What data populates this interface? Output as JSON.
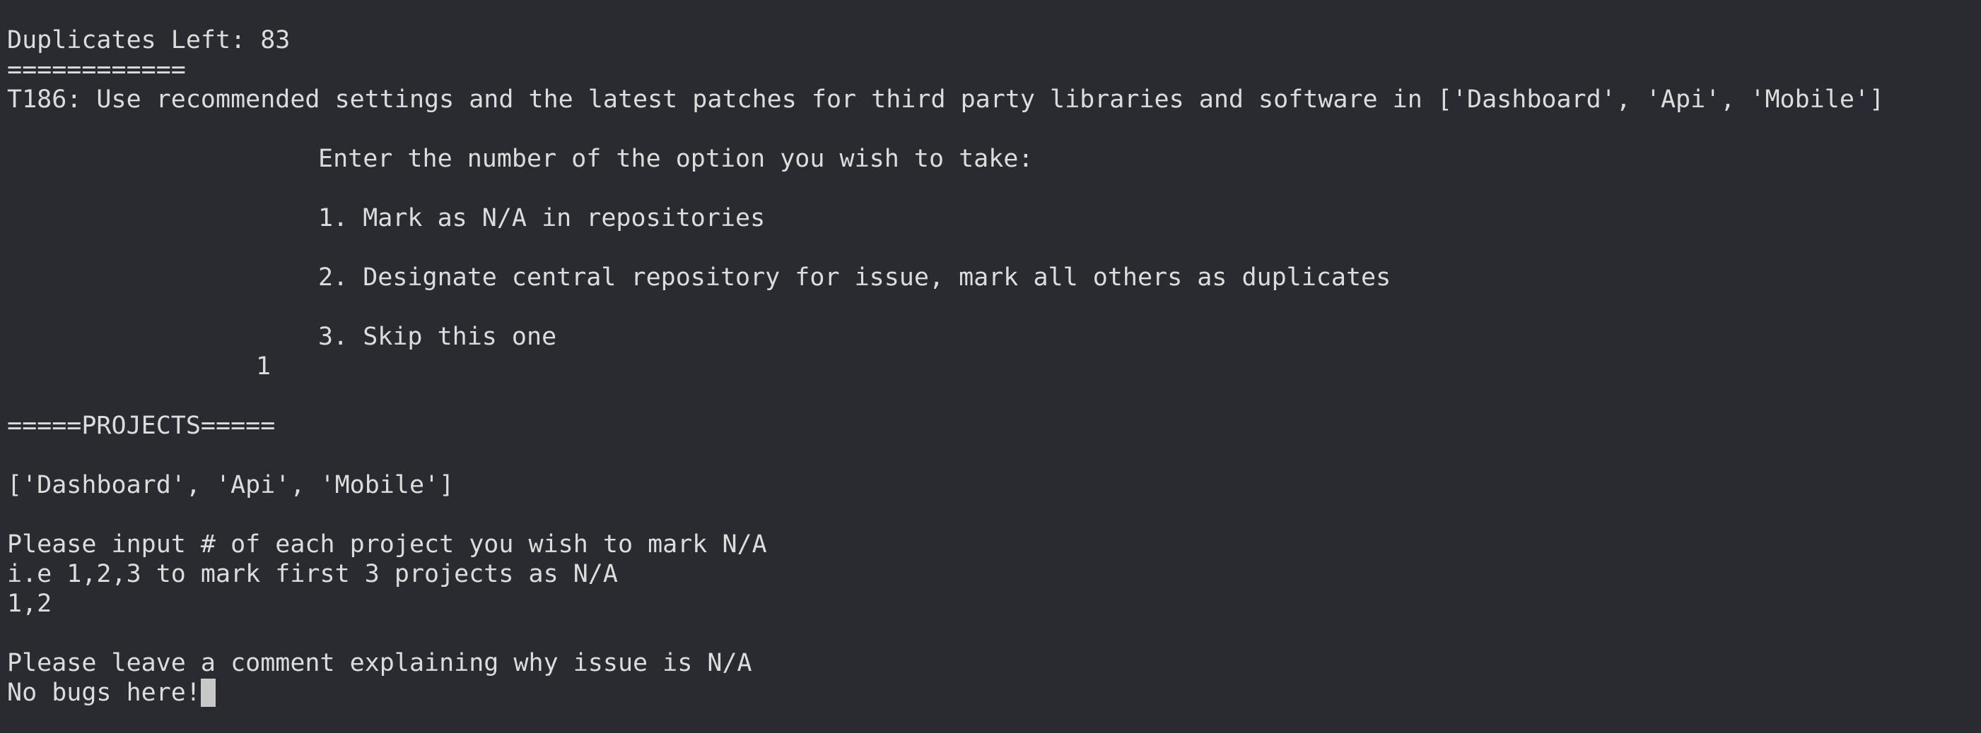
{
  "terminal": {
    "duplicates_left": "Duplicates Left: 83",
    "separator": "============",
    "task": "T186: Use recommended settings and the latest patches for third party libraries and software in ['Dashboard', 'Api', 'Mobile']",
    "prompt_title": "Enter the number of the option you wish to take:",
    "options": [
      "1. Mark as N/A in repositories",
      "2. Designate central repository for issue, mark all others as duplicates",
      "3. Skip this one"
    ],
    "option_input": "1",
    "projects_header": "=====PROJECTS=====",
    "projects_list": "['Dashboard', 'Api', 'Mobile']",
    "input_instruction_1": "Please input # of each project you wish to mark N/A",
    "input_instruction_2": "i.e 1,2,3 to mark first 3 projects as N/A",
    "projects_input": "1,2",
    "comment_prompt": "Please leave a comment explaining why issue is N/A",
    "comment_input": "No bugs here!"
  }
}
